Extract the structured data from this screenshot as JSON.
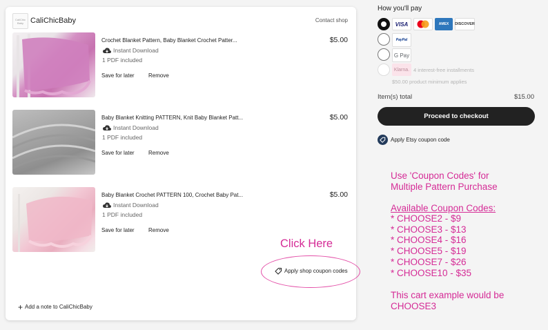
{
  "shop": {
    "name": "CaliChicBaby",
    "contact_label": "Contact shop",
    "logo_text": "CaliChic Baby"
  },
  "items": [
    {
      "title": "Crochet Blanket Pattern, Baby Blanket Crochet Patter...",
      "price": "$5.00",
      "download": "Instant Download",
      "files": "1 PDF included",
      "save_label": "Save for later",
      "remove_label": "Remove",
      "thumb": "pink crochet blanket",
      "thumb_color": "#d48fc3"
    },
    {
      "title": "Baby Blanket Knitting PATTERN, Knit Baby Blanket Patt...",
      "price": "$5.00",
      "download": "Instant Download",
      "files": "1 PDF included",
      "save_label": "Save for later",
      "remove_label": "Remove",
      "thumb": "gray knit blanket",
      "thumb_color": "#a9a9a9"
    },
    {
      "title": "Baby Blanket Crochet PATTERN 100, Crochet Baby Pat...",
      "price": "$5.00",
      "download": "Instant Download",
      "files": "1 PDF included",
      "save_label": "Save for later",
      "remove_label": "Remove",
      "thumb": "light pink crochet blanket",
      "thumb_color": "#efc2cf"
    }
  ],
  "apply_shop_coupon": "Apply shop coupon codes",
  "add_note": "Add a note to CaliChicBaby",
  "payment": {
    "title": "How you'll pay",
    "cards": [
      "VISA",
      "Mastercard",
      "AMEX",
      "DISCOVER"
    ],
    "paypal": "PayPal",
    "gpay": "G Pay",
    "klarna_logo": "Klarna.",
    "klarna_text": "4 interest-free installments",
    "klarna_min": "$50.00 product minimum applies",
    "items_total_label": "Item(s) total",
    "items_total_value": "$15.00",
    "checkout_label": "Proceed to checkout",
    "etsy_coupon_label": "Apply Etsy coupon code"
  },
  "annotation": {
    "click_here": "Click Here",
    "line1": "Use 'Coupon Codes' for",
    "line2": "Multiple Pattern Purchase",
    "available": "Available Coupon Codes:",
    "codes": [
      "* CHOOSE2 - $9",
      "* CHOOSE3 - $13",
      "* CHOOSE4 - $16",
      "* CHOOSE5 - $19",
      "* CHOOSE7 - $26",
      "* CHOOSE10 - $35"
    ],
    "example1": "This cart example would be",
    "example2": "CHOOSE3"
  },
  "colors": {
    "accent": "#d52b96",
    "checkout_bg": "#222222",
    "page_bg": "#f4f4f4"
  }
}
